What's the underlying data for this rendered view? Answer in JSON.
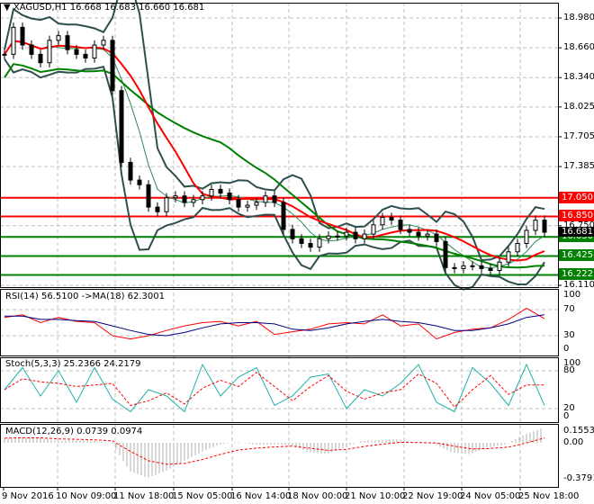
{
  "header": {
    "symbol": "XAGUSD,H1",
    "ohlc": "16.668 16.683 16.660 16.681"
  },
  "colors": {
    "up": "#000000",
    "red": "#ff0000",
    "green": "#008000",
    "band": "#2f4f4f",
    "rsi_ma": "#000080",
    "stoch": "#20b2aa"
  },
  "price_axis": [
    "18.980",
    "18.660",
    "18.340",
    "18.025",
    "17.705",
    "17.385",
    "16.750",
    "16.110"
  ],
  "levels": [
    {
      "value": "17.050",
      "color": "red"
    },
    {
      "value": "16.850",
      "color": "red"
    },
    {
      "value": "16.630",
      "color": "green"
    },
    {
      "value": "16.425",
      "color": "green"
    },
    {
      "value": "16.222",
      "color": "green"
    }
  ],
  "current_price": "16.681",
  "time_axis": [
    "9 Nov 2016",
    "10 Nov 09:00",
    "11 Nov 18:00",
    "15 Nov 05:00",
    "16 Nov 14:00",
    "18 Nov 00:00",
    "21 Nov 10:00",
    "22 Nov 19:00",
    "24 Nov 05:00",
    "25 Nov 18:00"
  ],
  "rsi": {
    "title": "RSI(14) 56.5100  ->MA(18) 62.3001",
    "axis": [
      "100",
      "70",
      "30",
      "0"
    ]
  },
  "stoch": {
    "title": "Stoch(5,3,3) 25.2366 24.2179",
    "axis": [
      "100",
      "80",
      "20",
      "0"
    ]
  },
  "macd": {
    "title": "MACD(12,26,9) 0.0739 0.0974",
    "axis": [
      "0.1553",
      "0.00",
      "-0.3791"
    ]
  },
  "chart_data": {
    "type": "candlestick",
    "symbol": "XAGUSD",
    "timeframe": "H1",
    "ylim": [
      16.11,
      18.98
    ],
    "close": [
      18.59,
      18.88,
      18.69,
      18.59,
      18.5,
      18.74,
      18.79,
      18.64,
      18.59,
      18.55,
      18.69,
      18.74,
      18.2,
      17.43,
      17.24,
      17.19,
      16.95,
      16.9,
      17.05,
      17.07,
      17.0,
      17.03,
      17.07,
      17.14,
      17.1,
      17.03,
      16.95,
      16.97,
      17.0,
      17.07,
      17.0,
      16.71,
      16.61,
      16.56,
      16.52,
      16.61,
      16.64,
      16.64,
      16.68,
      16.61,
      16.66,
      16.76,
      16.84,
      16.81,
      16.71,
      16.68,
      16.64,
      16.66,
      16.58,
      16.3,
      16.29,
      16.32,
      16.32,
      16.29,
      16.27,
      16.36,
      16.47,
      16.56,
      16.7,
      16.81,
      16.68
    ],
    "rsi_values": [
      58,
      62,
      50,
      58,
      52,
      50,
      30,
      25,
      30,
      38,
      45,
      50,
      52,
      45,
      52,
      32,
      36,
      40,
      48,
      50,
      48,
      62,
      45,
      48,
      25,
      35,
      40,
      42,
      55,
      72,
      56
    ],
    "rsi_ma_values": [
      60,
      60,
      55,
      55,
      53,
      52,
      45,
      38,
      32,
      30,
      35,
      42,
      48,
      50,
      50,
      48,
      40,
      38,
      42,
      48,
      52,
      55,
      52,
      50,
      45,
      38,
      38,
      42,
      48,
      58,
      62
    ],
    "stoch_values": [
      50,
      85,
      40,
      80,
      30,
      85,
      35,
      15,
      50,
      40,
      15,
      90,
      40,
      70,
      85,
      25,
      40,
      70,
      75,
      20,
      50,
      40,
      60,
      90,
      30,
      15,
      85,
      60,
      25,
      90,
      25
    ],
    "macd_hist": [
      0.05,
      0.06,
      0.05,
      0.02,
      0.03,
      0.02,
      0,
      -0.3,
      -0.37,
      -0.3,
      -0.2,
      -0.1,
      -0.02,
      0.01,
      -0.02,
      -0.02,
      -0.02,
      -0.1,
      -0.12,
      -0.05,
      0.02,
      0.03,
      0.04,
      0,
      -0.01,
      -0.1,
      -0.12,
      -0.05,
      -0.02,
      0.08,
      0.15
    ]
  }
}
